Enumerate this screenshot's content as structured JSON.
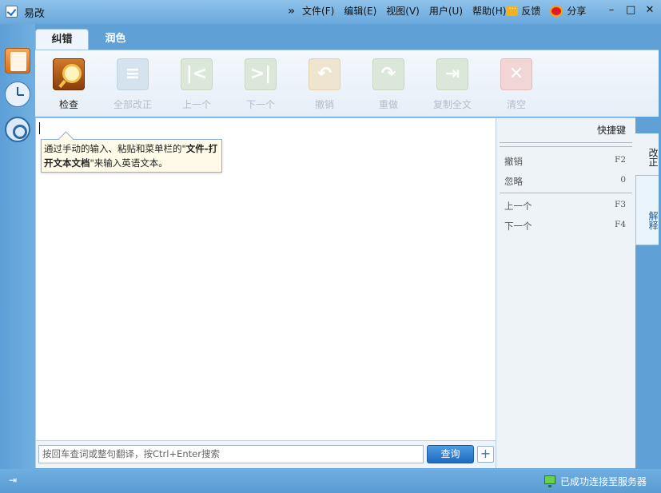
{
  "window": {
    "title": "易改",
    "controls": {
      "minimize": "–",
      "maximize": "□",
      "close": "✕"
    }
  },
  "menu": {
    "overflow": "»",
    "items": [
      "文件(F)",
      "编辑(E)",
      "视图(V)",
      "用户(U)",
      "帮助(H)"
    ],
    "feedback": "反馈",
    "share": "分享"
  },
  "tabs": [
    "纠错",
    "润色"
  ],
  "toolbar": [
    {
      "label": "检查",
      "icon": "magnifier-book-icon",
      "enabled": true
    },
    {
      "label": "全部改正",
      "icon": "list-icon",
      "enabled": false
    },
    {
      "label": "上一个",
      "icon": "first-icon",
      "enabled": false
    },
    {
      "label": "下一个",
      "icon": "next-icon",
      "enabled": false
    },
    {
      "label": "撤销",
      "icon": "undo-icon",
      "enabled": false
    },
    {
      "label": "重做",
      "icon": "redo-icon",
      "enabled": false
    },
    {
      "label": "复制全文",
      "icon": "copy-icon",
      "enabled": false
    },
    {
      "label": "清空",
      "icon": "clear-icon",
      "enabled": false
    }
  ],
  "editor": {
    "tip_pre": "通过手动的输入、粘贴和菜单栏的\"",
    "tip_bold": "文件-打开文本文档",
    "tip_post": "\"来输入英语文本。"
  },
  "search": {
    "placeholder": "按回车查词或整句翻译，按Ctrl+Enter搜索",
    "button": "查询",
    "add": "+"
  },
  "shortcuts": {
    "title": "快捷键",
    "rows": [
      {
        "name": "撤销",
        "key": "F2"
      },
      {
        "name": "忽略",
        "key": "0"
      },
      {
        "name": "上一个",
        "key": "F3"
      },
      {
        "name": "下一个",
        "key": "F4"
      }
    ]
  },
  "side_tabs": [
    "改正",
    "解释"
  ],
  "status": {
    "text": "已成功连接至服务器"
  },
  "colors": {
    "titlebar": "#6aa9dd",
    "accent": "#1e6ac0",
    "panel": "#eef3f8"
  }
}
